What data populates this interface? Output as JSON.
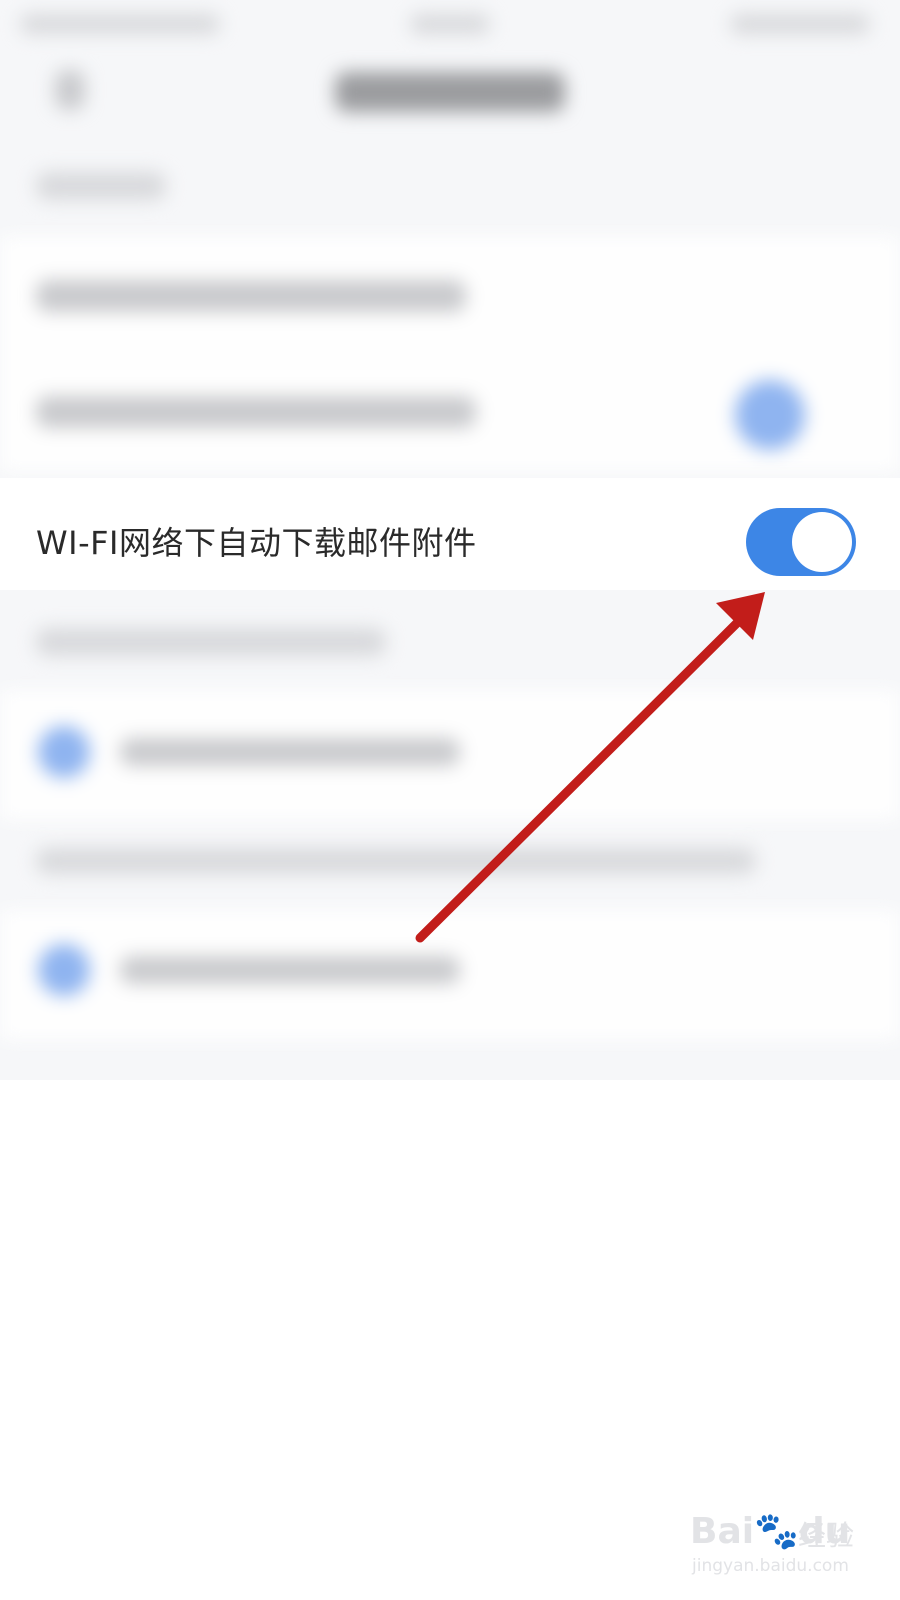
{
  "settings_row": {
    "label": "WI-FI网络下自动下载邮件附件",
    "toggle_on": true
  },
  "colors": {
    "toggle_on": "#3d86e6",
    "arrow": "#c21d1a",
    "text": "#2a2a2a"
  },
  "watermark": {
    "brand": "Bai",
    "brand_suffix": "du",
    "cn": "经验",
    "url": "jingyan.baidu.com"
  }
}
